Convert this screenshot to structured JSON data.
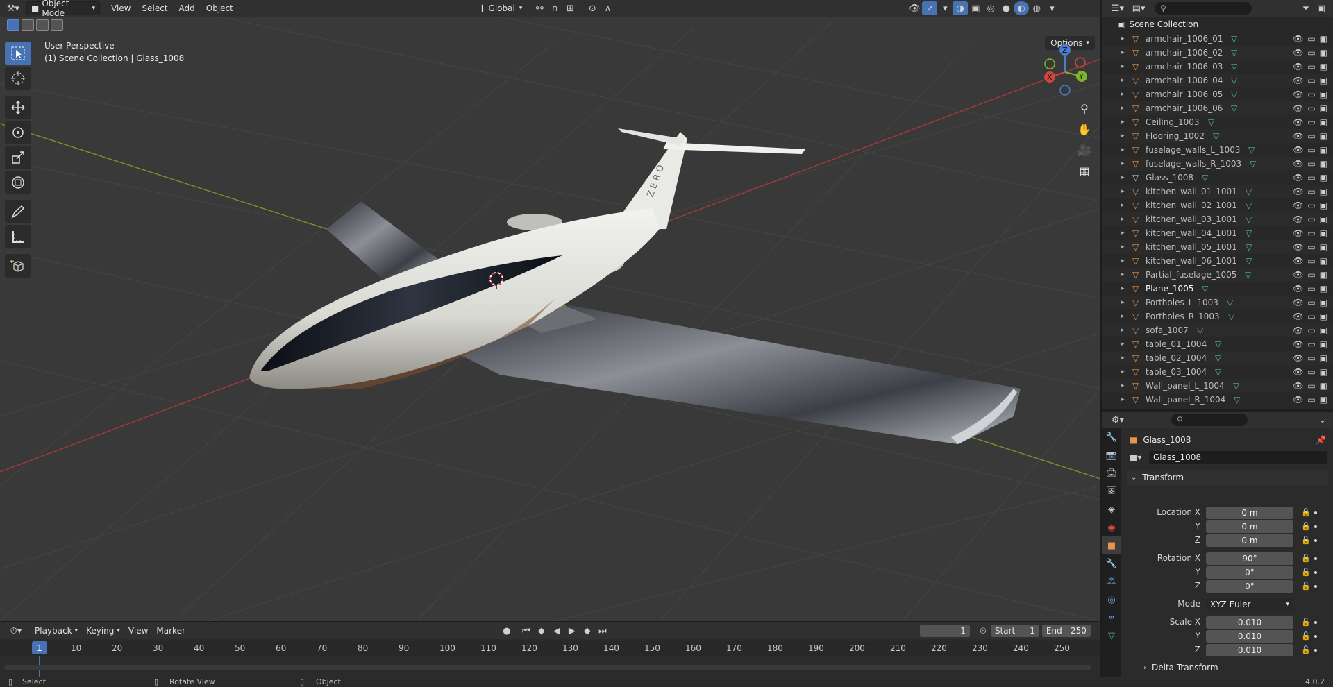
{
  "header": {
    "mode": "Object Mode",
    "menus": [
      "View",
      "Select",
      "Add",
      "Object"
    ],
    "transform_orientation": "Global"
  },
  "viewport": {
    "perspective_label": "User Perspective",
    "context_label": "(1) Scene Collection | Glass_1008",
    "options_label": "Options",
    "gizmo": {
      "z": "Z",
      "y": "Y",
      "x": "X"
    },
    "plane_text": "ZERO"
  },
  "timeline": {
    "menus": [
      "Playback",
      "Keying",
      "View",
      "Marker"
    ],
    "current_frame": "1",
    "start_label": "Start",
    "start_value": "1",
    "end_label": "End",
    "end_value": "250",
    "ruler_current": "1",
    "ruler_ticks": [
      "10",
      "20",
      "30",
      "40",
      "50",
      "60",
      "70",
      "80",
      "90",
      "100",
      "110",
      "120",
      "130",
      "140",
      "150",
      "160",
      "170",
      "180",
      "190",
      "200",
      "210",
      "220",
      "230",
      "240",
      "250"
    ]
  },
  "statusbar": {
    "select": "Select",
    "rotate": "Rotate View",
    "object": "Object",
    "version": "4.0.2"
  },
  "outliner": {
    "root": "Scene Collection",
    "items": [
      "armchair_1006_01",
      "armchair_1006_02",
      "armchair_1006_03",
      "armchair_1006_04",
      "armchair_1006_05",
      "armchair_1006_06",
      "Ceiling_1003",
      "Flooring_1002",
      "fuselage_walls_L_1003",
      "fuselage_walls_R_1003",
      "Glass_1008",
      "kitchen_wall_01_1001",
      "kitchen_wall_02_1001",
      "kitchen_wall_03_1001",
      "kitchen_wall_04_1001",
      "kitchen_wall_05_1001",
      "kitchen_wall_06_1001",
      "Partial_fuselage_1005",
      "Plane_1005",
      "Portholes_L_1003",
      "Portholes_R_1003",
      "sofa_1007",
      "table_01_1004",
      "table_02_1004",
      "table_03_1004",
      "Wall_panel_L_1004",
      "Wall_panel_R_1004"
    ]
  },
  "properties": {
    "object_name": "Glass_1008",
    "data_name": "Glass_1008",
    "transform_label": "Transform",
    "location_label": "Location X",
    "y_label": "Y",
    "z_label": "Z",
    "loc_x": "0 m",
    "loc_y": "0 m",
    "loc_z": "0 m",
    "rotation_label": "Rotation X",
    "rot_x": "90°",
    "rot_y": "0°",
    "rot_z": "0°",
    "mode_label": "Mode",
    "mode_value": "XYZ Euler",
    "scale_label": "Scale X",
    "scale_x": "0.010",
    "scale_y": "0.010",
    "scale_z": "0.010",
    "delta_label": "Delta Transform"
  },
  "colors": {
    "accent": "#4772b3",
    "mesh_icon": "#4dbf9b",
    "object_icon": "#e8944a",
    "grid_x_axis": "#b03a3a",
    "grid_y_axis": "#7a9a2a"
  }
}
